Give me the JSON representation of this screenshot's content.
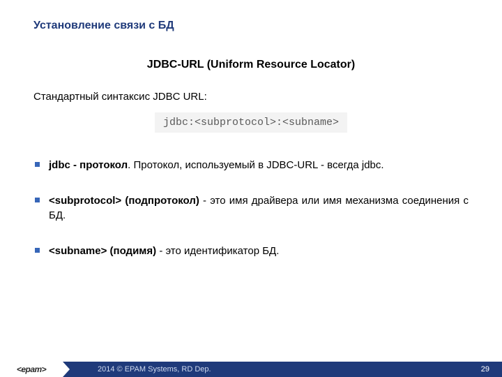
{
  "title": "Установление связи с БД",
  "heading": "JDBC-URL (Uniform Resource Locator)",
  "intro": "Стандартный синтаксис JDBC URL:",
  "code": "jdbc:<subprotocol>:<subname>",
  "bullets": [
    {
      "bold": "jdbc - протокол",
      "rest": ". Протокол, используемый в JDBC-URL - всегда jdbc."
    },
    {
      "bold": "<subprotocol> (подпротокол)",
      "rest": " - это имя драйвера или имя механизма соединения с БД."
    },
    {
      "bold": "<subname> (подимя)",
      "rest": " - это идентификатор БД."
    }
  ],
  "footer": {
    "logo": "<epam>",
    "copyright": "2014 © EPAM Systems, RD Dep.",
    "page": "29"
  }
}
